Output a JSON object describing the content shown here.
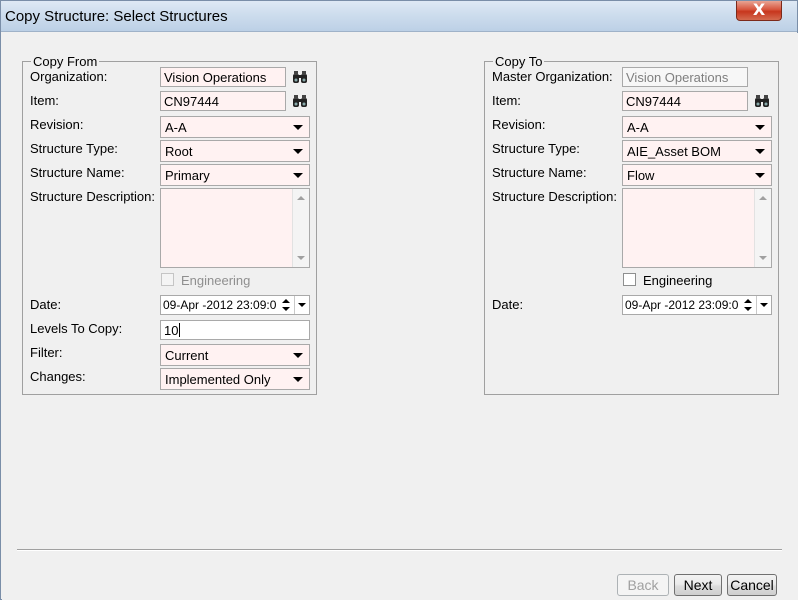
{
  "window": {
    "title": "Copy Structure: Select Structures",
    "close_label": "X"
  },
  "copy_from": {
    "legend": "Copy From",
    "organization": {
      "label": "Organization:",
      "value": "Vision Operations"
    },
    "item": {
      "label": "Item:",
      "value": "CN97444"
    },
    "revision": {
      "label": "Revision:",
      "value": "A-A"
    },
    "structure_type": {
      "label": "Structure Type:",
      "value": "Root"
    },
    "structure_name": {
      "label": "Structure Name:",
      "value": "Primary"
    },
    "structure_description": {
      "label": "Structure Description:",
      "value": ""
    },
    "engineering": {
      "label": "Engineering",
      "checked": false,
      "enabled": false
    },
    "date": {
      "label": "Date:",
      "value": "09-Apr -2012 23:09:0"
    },
    "levels_to_copy": {
      "label": "Levels To Copy:",
      "value": "10"
    },
    "filter": {
      "label": "Filter:",
      "value": "Current"
    },
    "changes": {
      "label": "Changes:",
      "value": "Implemented Only"
    }
  },
  "copy_to": {
    "legend": "Copy To",
    "master_organization": {
      "label": "Master Organization:",
      "value": "Vision Operations"
    },
    "item": {
      "label": "Item:",
      "value": "CN97444"
    },
    "revision": {
      "label": "Revision:",
      "value": "A-A"
    },
    "structure_type": {
      "label": "Structure Type:",
      "value": "AIE_Asset BOM"
    },
    "structure_name": {
      "label": "Structure Name:",
      "value": "Flow"
    },
    "structure_description": {
      "label": "Structure Description:",
      "value": ""
    },
    "engineering": {
      "label": "Engineering",
      "checked": false,
      "enabled": true
    },
    "date": {
      "label": "Date:",
      "value": "09-Apr -2012 23:09:0"
    }
  },
  "buttons": {
    "back": "Back",
    "next": "Next",
    "cancel": "Cancel"
  },
  "icons": {
    "lov": "binoculars-icon"
  },
  "colors": {
    "required_field": "#fff2f2",
    "titlebar": "#cfdeee",
    "close": "#c7361d"
  }
}
